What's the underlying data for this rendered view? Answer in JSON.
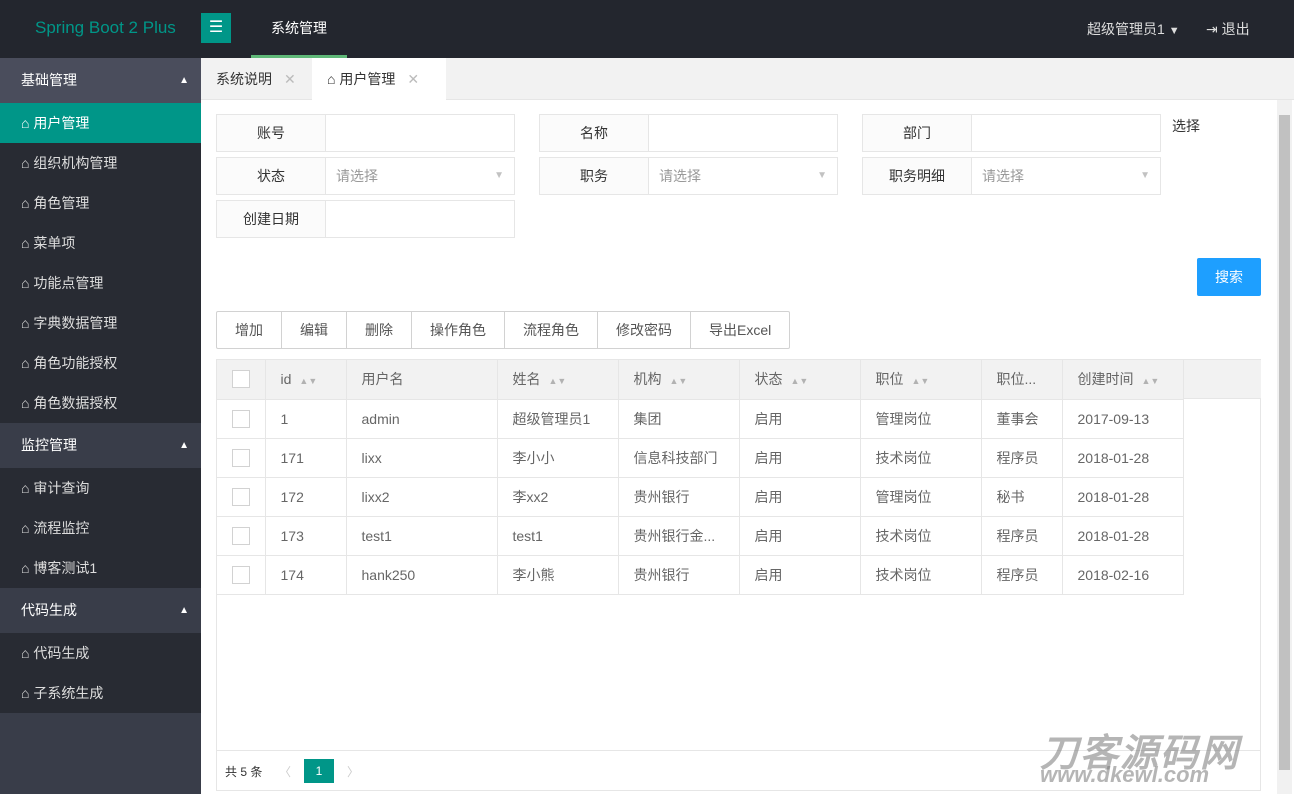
{
  "header": {
    "logo": "Spring Boot 2 Plus",
    "menu_icon": "list-icon",
    "nav": "系统管理",
    "user": "超级管理员1",
    "user_caret": "▼",
    "logout": "退出"
  },
  "sidebar": {
    "groups": [
      {
        "label": "基础管理",
        "items": [
          "用户管理",
          "组织机构管理",
          "角色管理",
          "菜单项",
          "功能点管理",
          "字典数据管理",
          "角色功能授权",
          "角色数据授权"
        ]
      },
      {
        "label": "监控管理",
        "items": [
          "审计查询",
          "流程监控",
          "博客测试1"
        ]
      },
      {
        "label": "代码生成",
        "items": [
          "代码生成",
          "子系统生成"
        ]
      }
    ],
    "active": "用户管理"
  },
  "tabs": [
    {
      "label": "系统说明"
    },
    {
      "label": "用户管理",
      "active": true
    }
  ],
  "form": {
    "fields": [
      {
        "label": "账号",
        "value": ""
      },
      {
        "label": "名称",
        "value": ""
      },
      {
        "label": "部门",
        "value": ""
      },
      {
        "label": "状态",
        "placeholder": "请选择"
      },
      {
        "label": "职务",
        "placeholder": "请选择"
      },
      {
        "label": "职务明细",
        "placeholder": "请选择"
      },
      {
        "label": "创建日期",
        "value": ""
      }
    ],
    "select_link": "选择",
    "search": "搜索"
  },
  "toolbar": [
    "增加",
    "编辑",
    "删除",
    "操作角色",
    "流程角色",
    "修改密码",
    "导出Excel"
  ],
  "table": {
    "columns": [
      "id",
      "用户名",
      "姓名",
      "机构",
      "状态",
      "职位",
      "职位...",
      "创建时间"
    ],
    "rows": [
      [
        "1",
        "admin",
        "超级管理员1",
        "集团",
        "启用",
        "管理岗位",
        "董事会",
        "2017-09-13"
      ],
      [
        "171",
        "lixx",
        "李小小",
        "信息科技部门",
        "启用",
        "技术岗位",
        "程序员",
        "2018-01-28"
      ],
      [
        "172",
        "lixx2",
        "李xx2",
        "贵州银行",
        "启用",
        "管理岗位",
        "秘书",
        "2018-01-28"
      ],
      [
        "173",
        "test1",
        "test1",
        "贵州银行金...",
        "启用",
        "技术岗位",
        "程序员",
        "2018-01-28"
      ],
      [
        "174",
        "hank250",
        "李小熊",
        "贵州银行",
        "启用",
        "技术岗位",
        "程序员",
        "2018-02-16"
      ]
    ]
  },
  "pagination": {
    "total": "共 5 条",
    "prev": "〈",
    "page": "1",
    "next": "〉"
  },
  "watermark": {
    "title": "刀客源码网",
    "url": "www.dkewl.com"
  }
}
